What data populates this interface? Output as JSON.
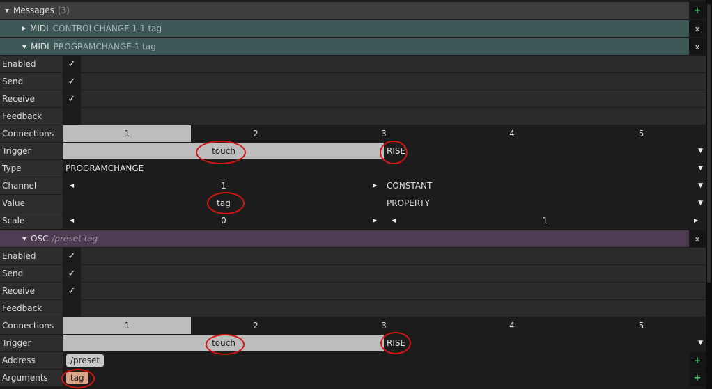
{
  "messages_header": {
    "title": "Messages",
    "count": "(3)",
    "add": "+"
  },
  "midi1": {
    "type": "MIDI",
    "summary": "CONTROLCHANGE 1 1 tag",
    "close": "x"
  },
  "midi2": {
    "type": "MIDI",
    "summary": "PROGRAMCHANGE 1 tag",
    "close": "x",
    "labels": {
      "enabled": "Enabled",
      "send": "Send",
      "receive": "Receive",
      "feedback": "Feedback",
      "connections": "Connections",
      "trigger": "Trigger",
      "type": "Type",
      "channel": "Channel",
      "value": "Value",
      "scale": "Scale"
    },
    "checks": {
      "enabled": "✓",
      "send": "✓",
      "receive": "✓",
      "feedback": ""
    },
    "connections": [
      "1",
      "2",
      "3",
      "4",
      "5"
    ],
    "trigger": {
      "source": "touch",
      "mode": "RISE"
    },
    "type_value": "PROGRAMCHANGE",
    "channel": {
      "value": "1",
      "mode": "CONSTANT"
    },
    "value": {
      "value": "tag",
      "mode": "PROPERTY"
    },
    "scale": {
      "min": "0",
      "max": "1"
    }
  },
  "osc": {
    "type": "OSC",
    "summary": "/preset tag",
    "close": "x",
    "labels": {
      "enabled": "Enabled",
      "send": "Send",
      "receive": "Receive",
      "feedback": "Feedback",
      "connections": "Connections",
      "trigger": "Trigger",
      "address": "Address",
      "arguments": "Arguments"
    },
    "checks": {
      "enabled": "✓",
      "send": "✓",
      "receive": "✓",
      "feedback": ""
    },
    "connections": [
      "1",
      "2",
      "3",
      "4",
      "5"
    ],
    "trigger": {
      "source": "touch",
      "mode": "RISE"
    },
    "address": "/preset",
    "arguments": "tag",
    "add": "+"
  },
  "colors": {
    "midi_header": "#3d5656",
    "osc_header": "#4e3d52",
    "messages_header": "#3f3f3f",
    "annotation": "#d41414",
    "tag_pill": "#d9a488"
  }
}
